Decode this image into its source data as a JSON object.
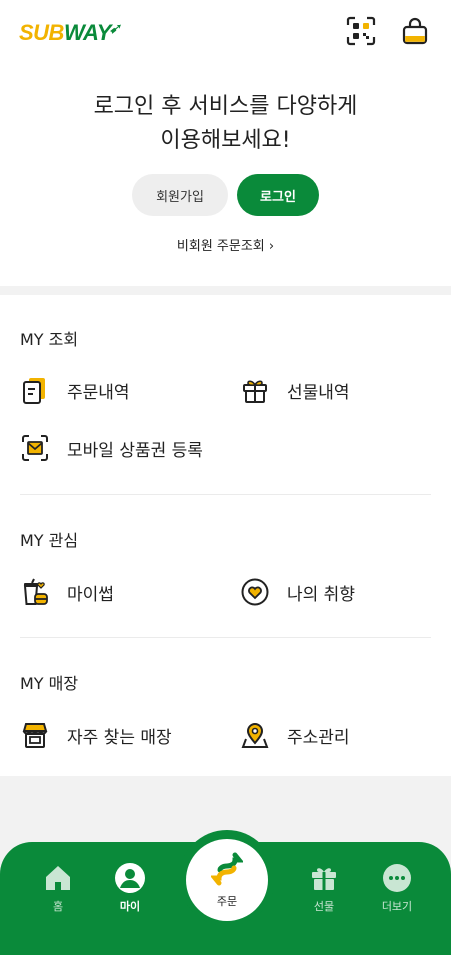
{
  "header": {
    "logo_yellow": "SUB",
    "logo_green": "WAY",
    "logo_arrow": "➹"
  },
  "welcome": {
    "line1": "로그인 후 서비스를 다양하게",
    "line2": "이용해보세요!"
  },
  "buttons": {
    "join": "회원가입",
    "login": "로그인"
  },
  "guest_order": "비회원 주문조회 ›",
  "sections": {
    "inquiry": {
      "title": "MY 조회",
      "items": [
        "주문내역",
        "선물내역",
        "모바일 상품권 등록"
      ]
    },
    "interest": {
      "title": "MY 관심",
      "items": [
        "마이썹",
        "나의 취향"
      ]
    },
    "store": {
      "title": "MY 매장",
      "items": [
        "자주 찾는 매장",
        "주소관리"
      ]
    }
  },
  "tabs": {
    "home": "홈",
    "my": "마이",
    "order": "주문",
    "gift": "선물",
    "more": "더보기"
  },
  "colors": {
    "brand_green": "#0a8a3a",
    "brand_yellow": "#f2b300"
  },
  "icons": [
    "qr-scan-icon",
    "cart-bag-icon",
    "order-receipt-icon",
    "gift-box-icon",
    "mobile-voucher-icon",
    "my-sub-icon",
    "heart-taste-icon",
    "store-icon",
    "map-pin-icon",
    "home-icon",
    "user-icon",
    "order-arrows-icon",
    "gift-icon",
    "more-icon"
  ]
}
